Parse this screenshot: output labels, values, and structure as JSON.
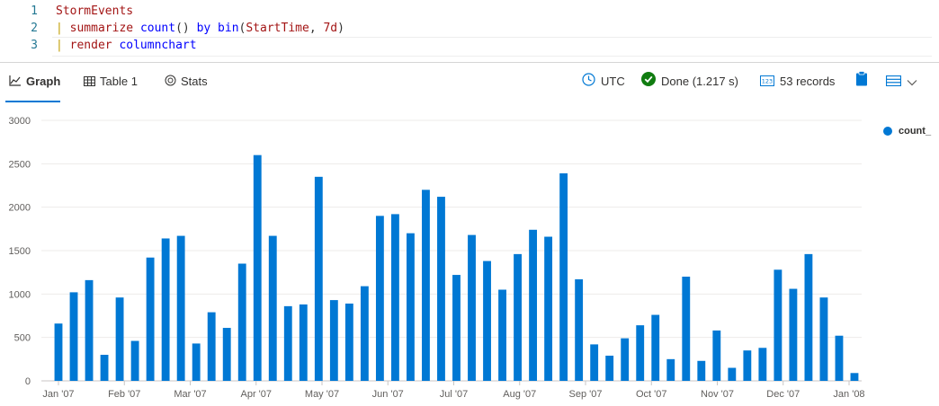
{
  "editor": {
    "lines": [
      {
        "num": "1",
        "table": "StormEvents"
      },
      {
        "num": "2",
        "pipe": "|",
        "kw": "summarize",
        "rest_fn": "count",
        "rest_a": "()",
        "by": "by",
        "bin_fn": "bin",
        "bin_open": "(",
        "bin_arg1": "StartTime",
        "bin_comma": ", ",
        "bin_arg2": "7d",
        "bin_close": ")"
      },
      {
        "num": "3",
        "pipe": "|",
        "kw": "render",
        "fn": "columnchart"
      }
    ]
  },
  "tabs": [
    {
      "label": "Graph",
      "icon": "line-chart-icon",
      "active": true
    },
    {
      "label": "Table 1",
      "icon": "table-icon",
      "active": false
    },
    {
      "label": "Stats",
      "icon": "stats-icon",
      "active": false
    }
  ],
  "status": {
    "timezone": "UTC",
    "done": "Done (1.217 s)",
    "records": "53 records"
  },
  "colors": {
    "accent": "#0078d4",
    "done": "#107c10"
  },
  "chart_data": {
    "type": "bar",
    "ylim": [
      0,
      3000
    ],
    "yticks": [
      0,
      500,
      1000,
      1500,
      2000,
      2500,
      3000
    ],
    "xticks": [
      "Jan '07",
      "Feb '07",
      "Mar '07",
      "Apr '07",
      "May '07",
      "Jun '07",
      "Jul '07",
      "Aug '07",
      "Sep '07",
      "Oct '07",
      "Nov '07",
      "Dec '07",
      "Jan '08"
    ],
    "series": [
      {
        "name": "count_",
        "values": [
          660,
          1020,
          1160,
          300,
          960,
          460,
          1420,
          1640,
          1670,
          430,
          790,
          610,
          1350,
          2600,
          1670,
          860,
          880,
          2350,
          930,
          890,
          1090,
          1900,
          1920,
          1700,
          2200,
          2120,
          1220,
          1680,
          1380,
          1050,
          1460,
          1740,
          1660,
          2390,
          1170,
          420,
          290,
          490,
          640,
          760,
          250,
          1200,
          230,
          580,
          150,
          350,
          380,
          1280,
          1060,
          1460,
          960,
          520,
          90
        ]
      }
    ],
    "legend": "top-right"
  }
}
